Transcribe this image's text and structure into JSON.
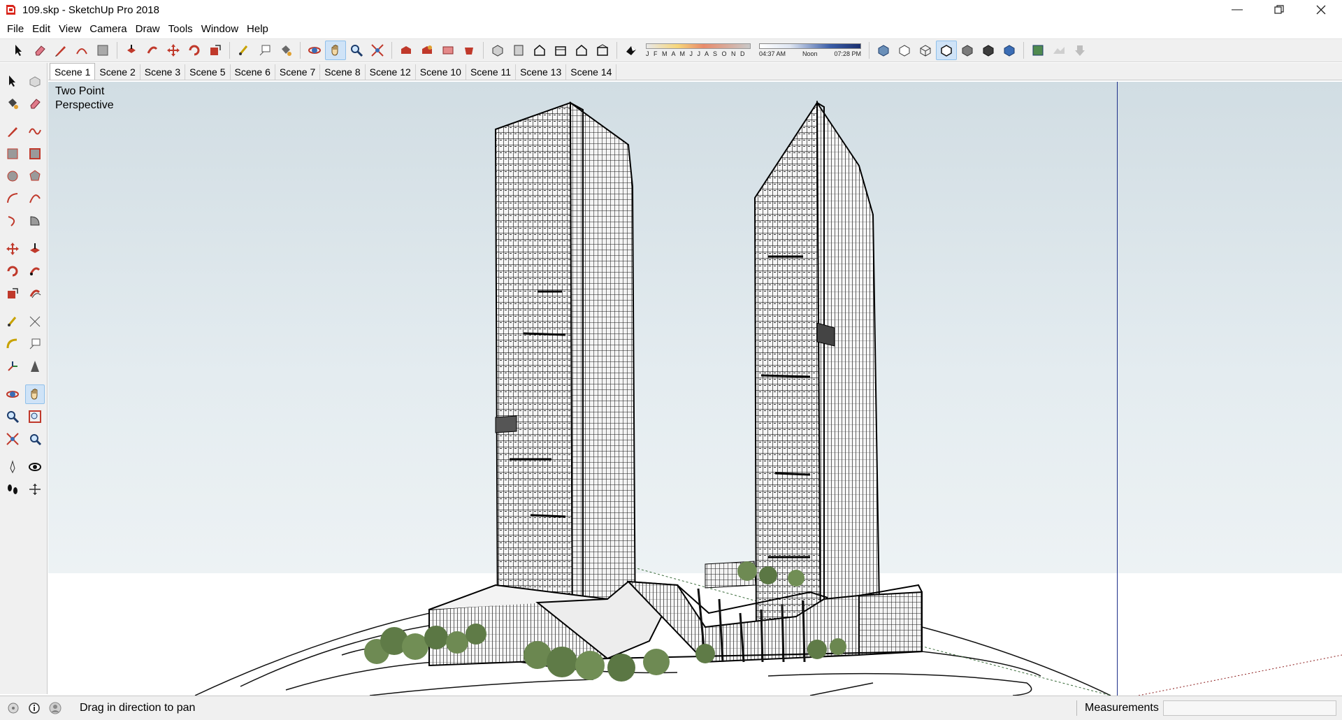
{
  "window": {
    "title": "109.skp - SketchUp Pro 2018",
    "controls": [
      "minimize",
      "restore",
      "close"
    ]
  },
  "menu": [
    "File",
    "Edit",
    "View",
    "Camera",
    "Draw",
    "Tools",
    "Window",
    "Help"
  ],
  "toolbar": {
    "shadow_months": "J F M A M J J A S O N D",
    "shadow_time_start": "04:37 AM",
    "shadow_time_mid": "Noon",
    "shadow_time_end": "07:28 PM",
    "active_tool": "pan-icon"
  },
  "scenes": {
    "tabs": [
      "Scene 1",
      "Scene 2",
      "Scene 3",
      "Scene 5",
      "Scene 6",
      "Scene 7",
      "Scene 8",
      "Scene 12",
      "Scene 10",
      "Scene 11",
      "Scene 13",
      "Scene 14"
    ],
    "active": "Scene 1"
  },
  "viewport": {
    "camera_label": "Two Point\nPerspective"
  },
  "status": {
    "hint": "Drag in direction to pan",
    "measurements_label": "Measurements",
    "measurements_value": ""
  },
  "colors": {
    "sky_top": "#d1dde3",
    "sky_bottom": "#edf2f4",
    "ground": "#ffffff",
    "toolbar_bg": "#f0f0f0",
    "active_highlight": "#cfe3f7",
    "guide_blue": "#1d2f8a"
  }
}
